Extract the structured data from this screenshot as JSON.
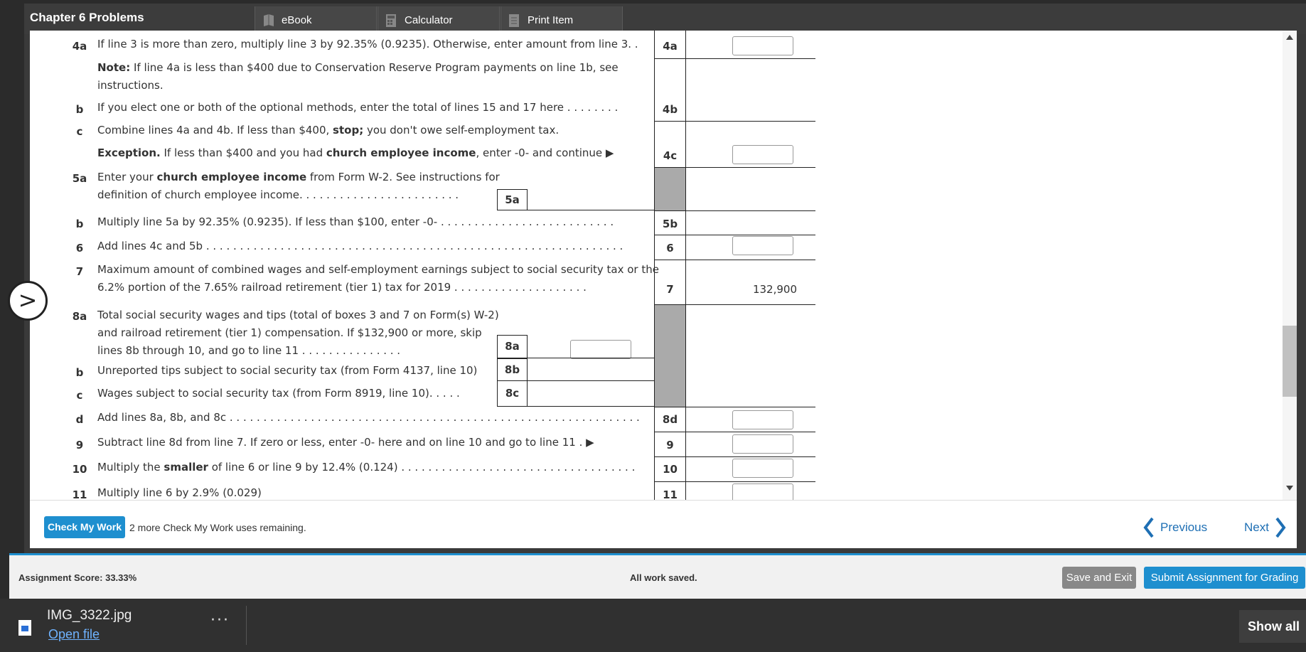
{
  "header": {
    "title": "Chapter 6 Problems",
    "tabs": [
      {
        "label": "eBook",
        "icon": "book-icon"
      },
      {
        "label": "Calculator",
        "icon": "calculator-icon"
      },
      {
        "label": "Print Item",
        "icon": "print-icon"
      }
    ]
  },
  "form": {
    "rows": {
      "r4a": {
        "num": "4a",
        "text": "If line 3 is more than zero, multiply line 3 by 92.35% (0.9235). Otherwise, enter amount from line 3. .",
        "box": "4a"
      },
      "note": {
        "label": "Note:",
        "text": " If line 4a is less than $400 due to Conservation Reserve Program payments on line 1b, see",
        "text2": "instructions."
      },
      "r4b": {
        "num": "b",
        "text": "If you elect one or both of the optional methods, enter the total of lines 15 and 17 here . . . . . . . .",
        "box": "4b"
      },
      "r4c": {
        "num": "c",
        "text_pre": "Combine lines 4a and 4b. If less than $400, ",
        "text_bold": "stop;",
        "text_post": " you don't owe self-employment tax.",
        "box": "4c"
      },
      "exception": {
        "label": "Exception.",
        "text_pre": " If less than $400 and you had ",
        "text_bold": "church employee income",
        "text_post": ", enter -0- and continue ▶"
      },
      "r5a": {
        "num": "5a",
        "text_pre": "Enter your ",
        "text_bold": "church employee income",
        "text_post": " from Form W-2. See instructions for",
        "text2": "definition of church employee income. . . . . . . . . . . . . . . . . . . . . . . .",
        "subbox": "5a"
      },
      "r5b": {
        "num": "b",
        "text": "Multiply line 5a by 92.35% (0.9235). If less than $100, enter -0- . . . . . . . . . . . . . . . . . . . . . . . . . .",
        "box": "5b"
      },
      "r6": {
        "num": "6",
        "text": "Add lines 4c and 5b . . . . . . . . . . . . . . . . . . . . . . . . . . . . . . . . . . . . . . . . . . . . . . . . . . . . . . . . . . . . . .",
        "box": "6"
      },
      "r7": {
        "num": "7",
        "text": "Maximum amount of combined wages and self-employment earnings subject to social security tax or the",
        "text2": "6.2% portion of the 7.65% railroad retirement (tier 1) tax for 2019 . . . . . . . . . . . . . . . . . . . .",
        "box": "7",
        "value": "132,900"
      },
      "r8a": {
        "num": "8a",
        "text": "Total social security wages and tips (total of boxes 3 and 7 on Form(s) W-2)",
        "text2": "and railroad retirement (tier 1) compensation. If $132,900 or more, skip",
        "text3": "lines 8b through 10, and go to line 11 . . . . . . . . . . . . . . .",
        "subbox": "8a"
      },
      "r8b": {
        "num": "b",
        "text": "Unreported tips subject to social security tax (from Form 4137, line 10)",
        "subbox": "8b"
      },
      "r8c": {
        "num": "c",
        "text": "Wages subject to social security tax (from Form 8919, line 10). . . . .",
        "subbox": "8c"
      },
      "r8d": {
        "num": "d",
        "text": "Add lines 8a, 8b, and 8c . . . . . . . . . . . . . . . . . . . . . . . . . . . . . . . . . . . . . . . . . . . . . . . . . . . . . . . . . . . . .",
        "box": "8d"
      },
      "r9": {
        "num": "9",
        "text": "Subtract line 8d from line 7. If zero or less, enter -0- here and on line 10 and go to line 11 . ▶",
        "box": "9"
      },
      "r10": {
        "num": "10",
        "text_pre": "Multiply the ",
        "text_bold": "smaller",
        "text_post": " of line 6 or line 9 by 12.4% (0.124) . . . . . . . . . . . . . . . . . . . . . . . . . . . . . . . . . . .",
        "box": "10"
      },
      "r11": {
        "num": "11",
        "text": "Multiply line 6 by 2.9% (0.029)",
        "box": "11"
      }
    }
  },
  "footer": {
    "check_label": "Check My Work",
    "remaining": "2 more Check My Work uses remaining.",
    "previous": "Previous",
    "next": "Next"
  },
  "scorebar": {
    "score": "Assignment Score: 33.33%",
    "saved": "All work saved.",
    "save_exit": "Save and Exit",
    "submit": "Submit Assignment for Grading"
  },
  "download": {
    "filename": "IMG_3322.jpg",
    "open": "Open file",
    "show_all": "Show all"
  }
}
